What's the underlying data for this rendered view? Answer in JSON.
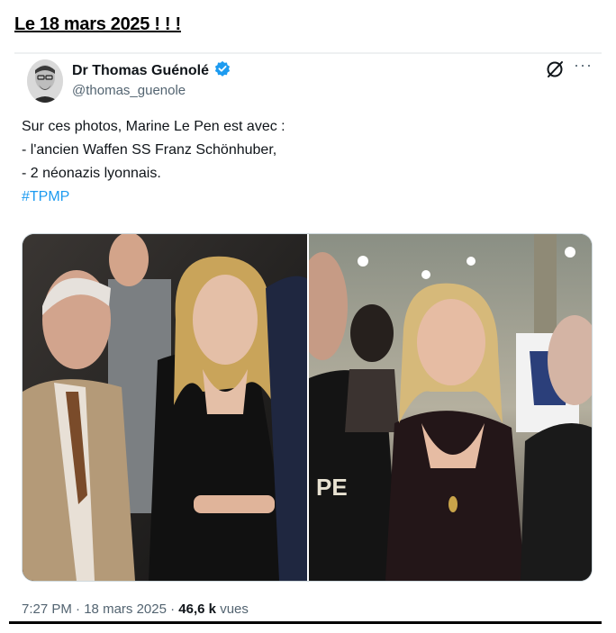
{
  "page": {
    "heading": "Le 18 mars 2025 ! ! !"
  },
  "tweet": {
    "author": {
      "display_name": "Dr Thomas Guénolé",
      "handle": "@thomas_guenole",
      "verified": true
    },
    "text_lines": [
      "Sur ces photos, Marine Le Pen est avec :",
      "- l'ancien Waffen SS Franz Schönhuber,",
      "- 2 néonazis lyonnais."
    ],
    "hashtag": "#TPMP",
    "meta": {
      "time": "7:27 PM",
      "separator": "·",
      "date": "18 mars 2025",
      "views_count": "46,6 k",
      "views_label": "vues"
    },
    "colors": {
      "accent": "#1d9bf0",
      "secondary_text": "#536471",
      "primary_text": "#0f1419"
    },
    "icons": [
      "verified-badge-icon",
      "grok-icon",
      "more-options-icon"
    ]
  }
}
